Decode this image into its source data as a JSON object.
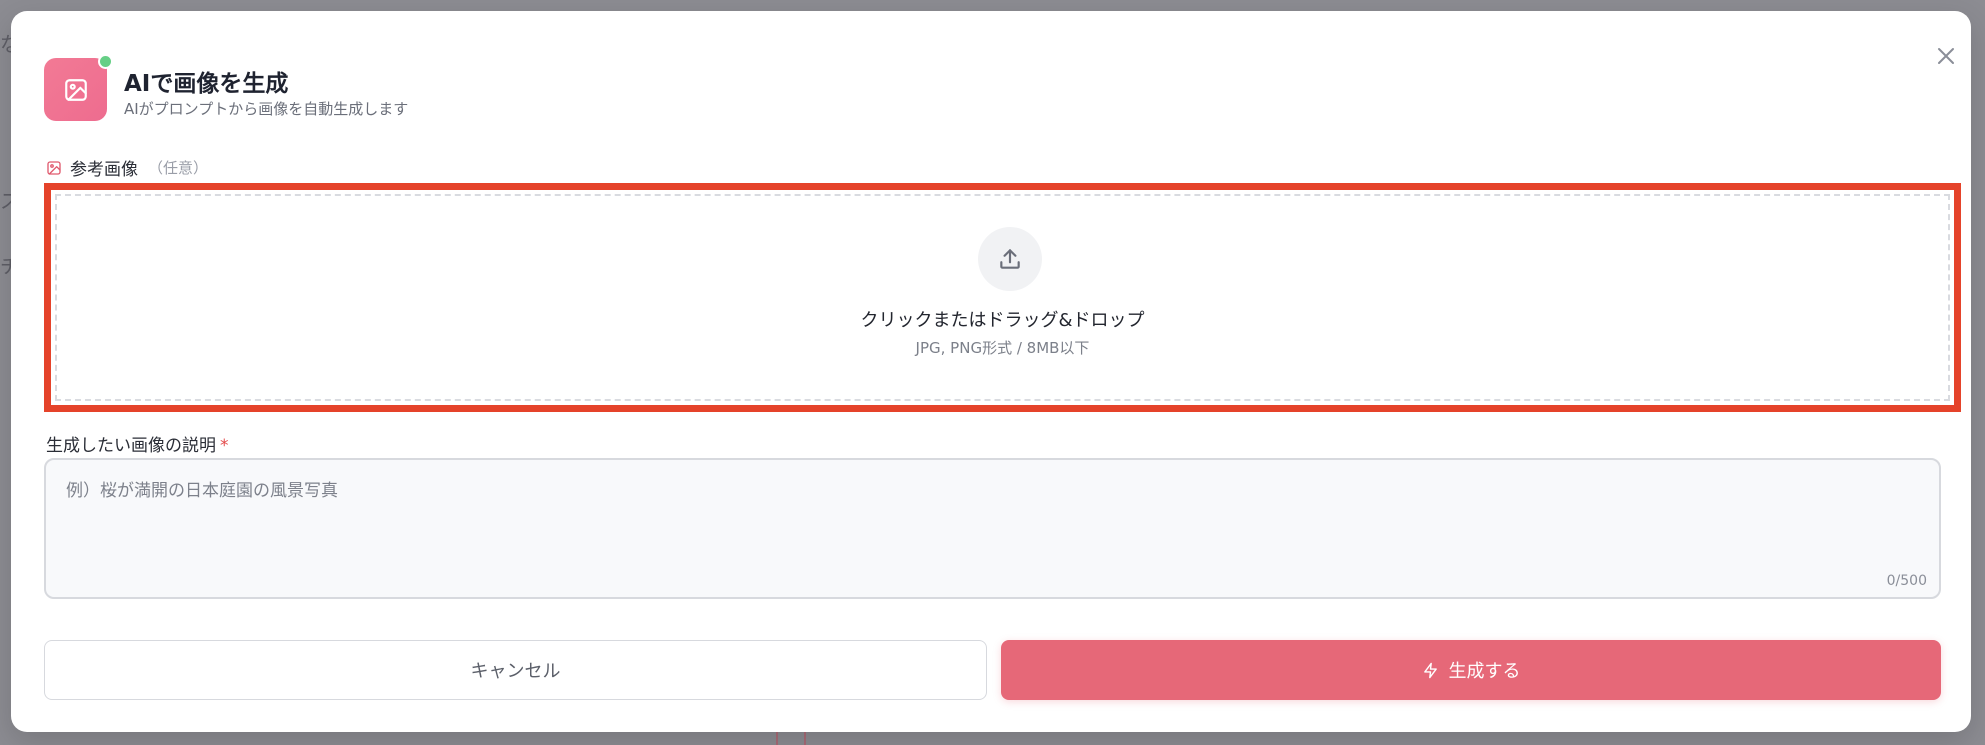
{
  "colors": {
    "accent": "#e66878",
    "icon_gradient_start": "#f27a95",
    "status_dot": "#66cf86",
    "highlight_border": "#e5432a",
    "required": "#e44a4a"
  },
  "dialog": {
    "title": "AIで画像を生成",
    "subtitle": "AIがプロンプトから画像を自動生成します",
    "header_icon": "image-icon",
    "close_icon": "close-icon"
  },
  "reference": {
    "label": "参考画像",
    "optional": "（任意）",
    "icon": "image-icon"
  },
  "upload": {
    "icon": "upload-icon",
    "main_text": "クリックまたはドラッグ&ドロップ",
    "sub_text": "JPG, PNG形式 / 8MB以下"
  },
  "description": {
    "label": "生成したい画像の説明",
    "required_mark": "*",
    "placeholder": "例）桜が満開の日本庭園の風景写真",
    "value": "",
    "char_count": "0/500"
  },
  "actions": {
    "cancel_label": "キャンセル",
    "generate_label": "生成する",
    "generate_icon": "lightning-icon"
  }
}
